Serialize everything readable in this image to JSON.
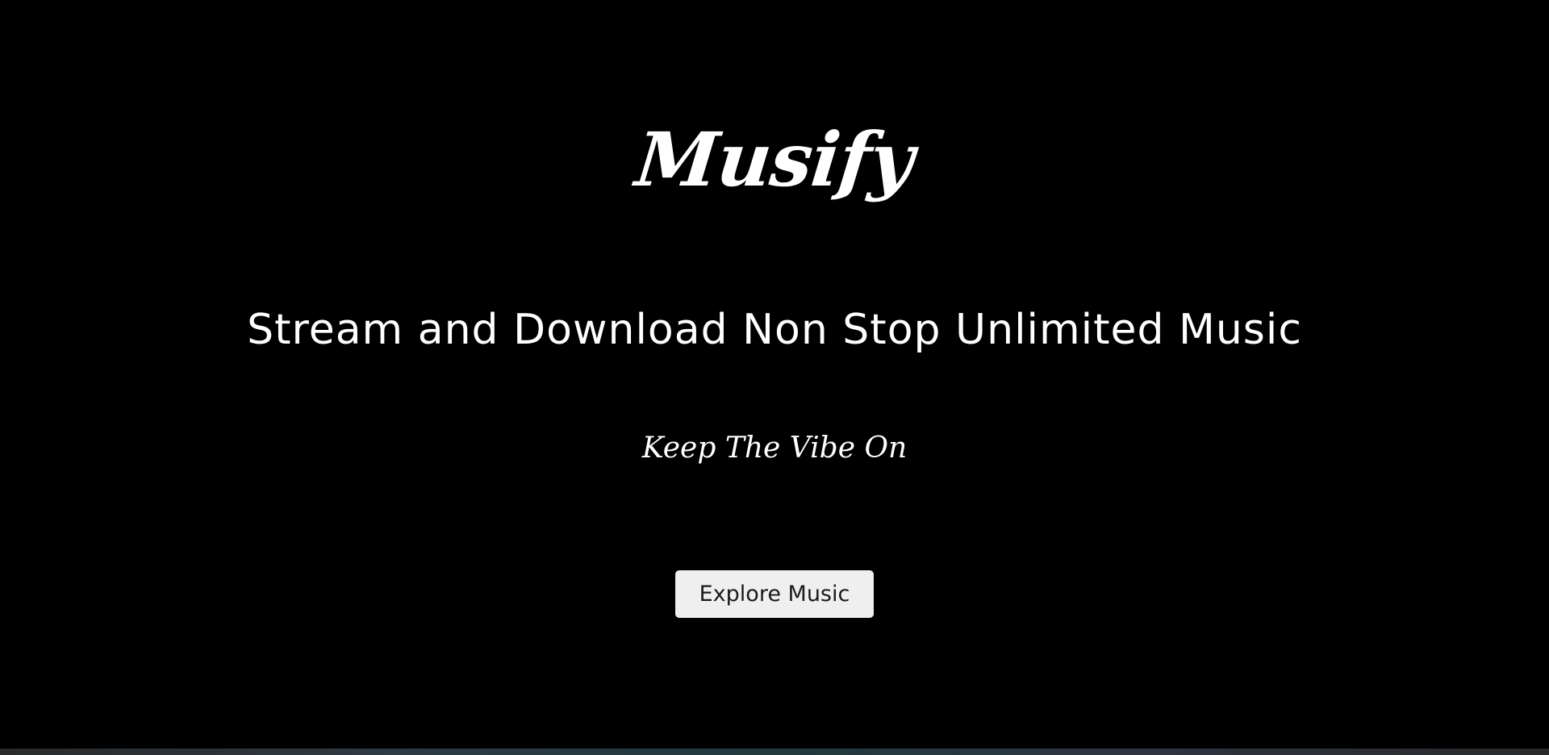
{
  "hero": {
    "brand": "Musify",
    "headline": "Stream and Download Non Stop Unlimited Music",
    "tagline": "Keep The Vibe On",
    "cta_label": "Explore Music"
  },
  "colors": {
    "background": "#000000",
    "text": "#ffffff",
    "button_bg": "#efefef",
    "button_text": "#1a1a1a"
  }
}
